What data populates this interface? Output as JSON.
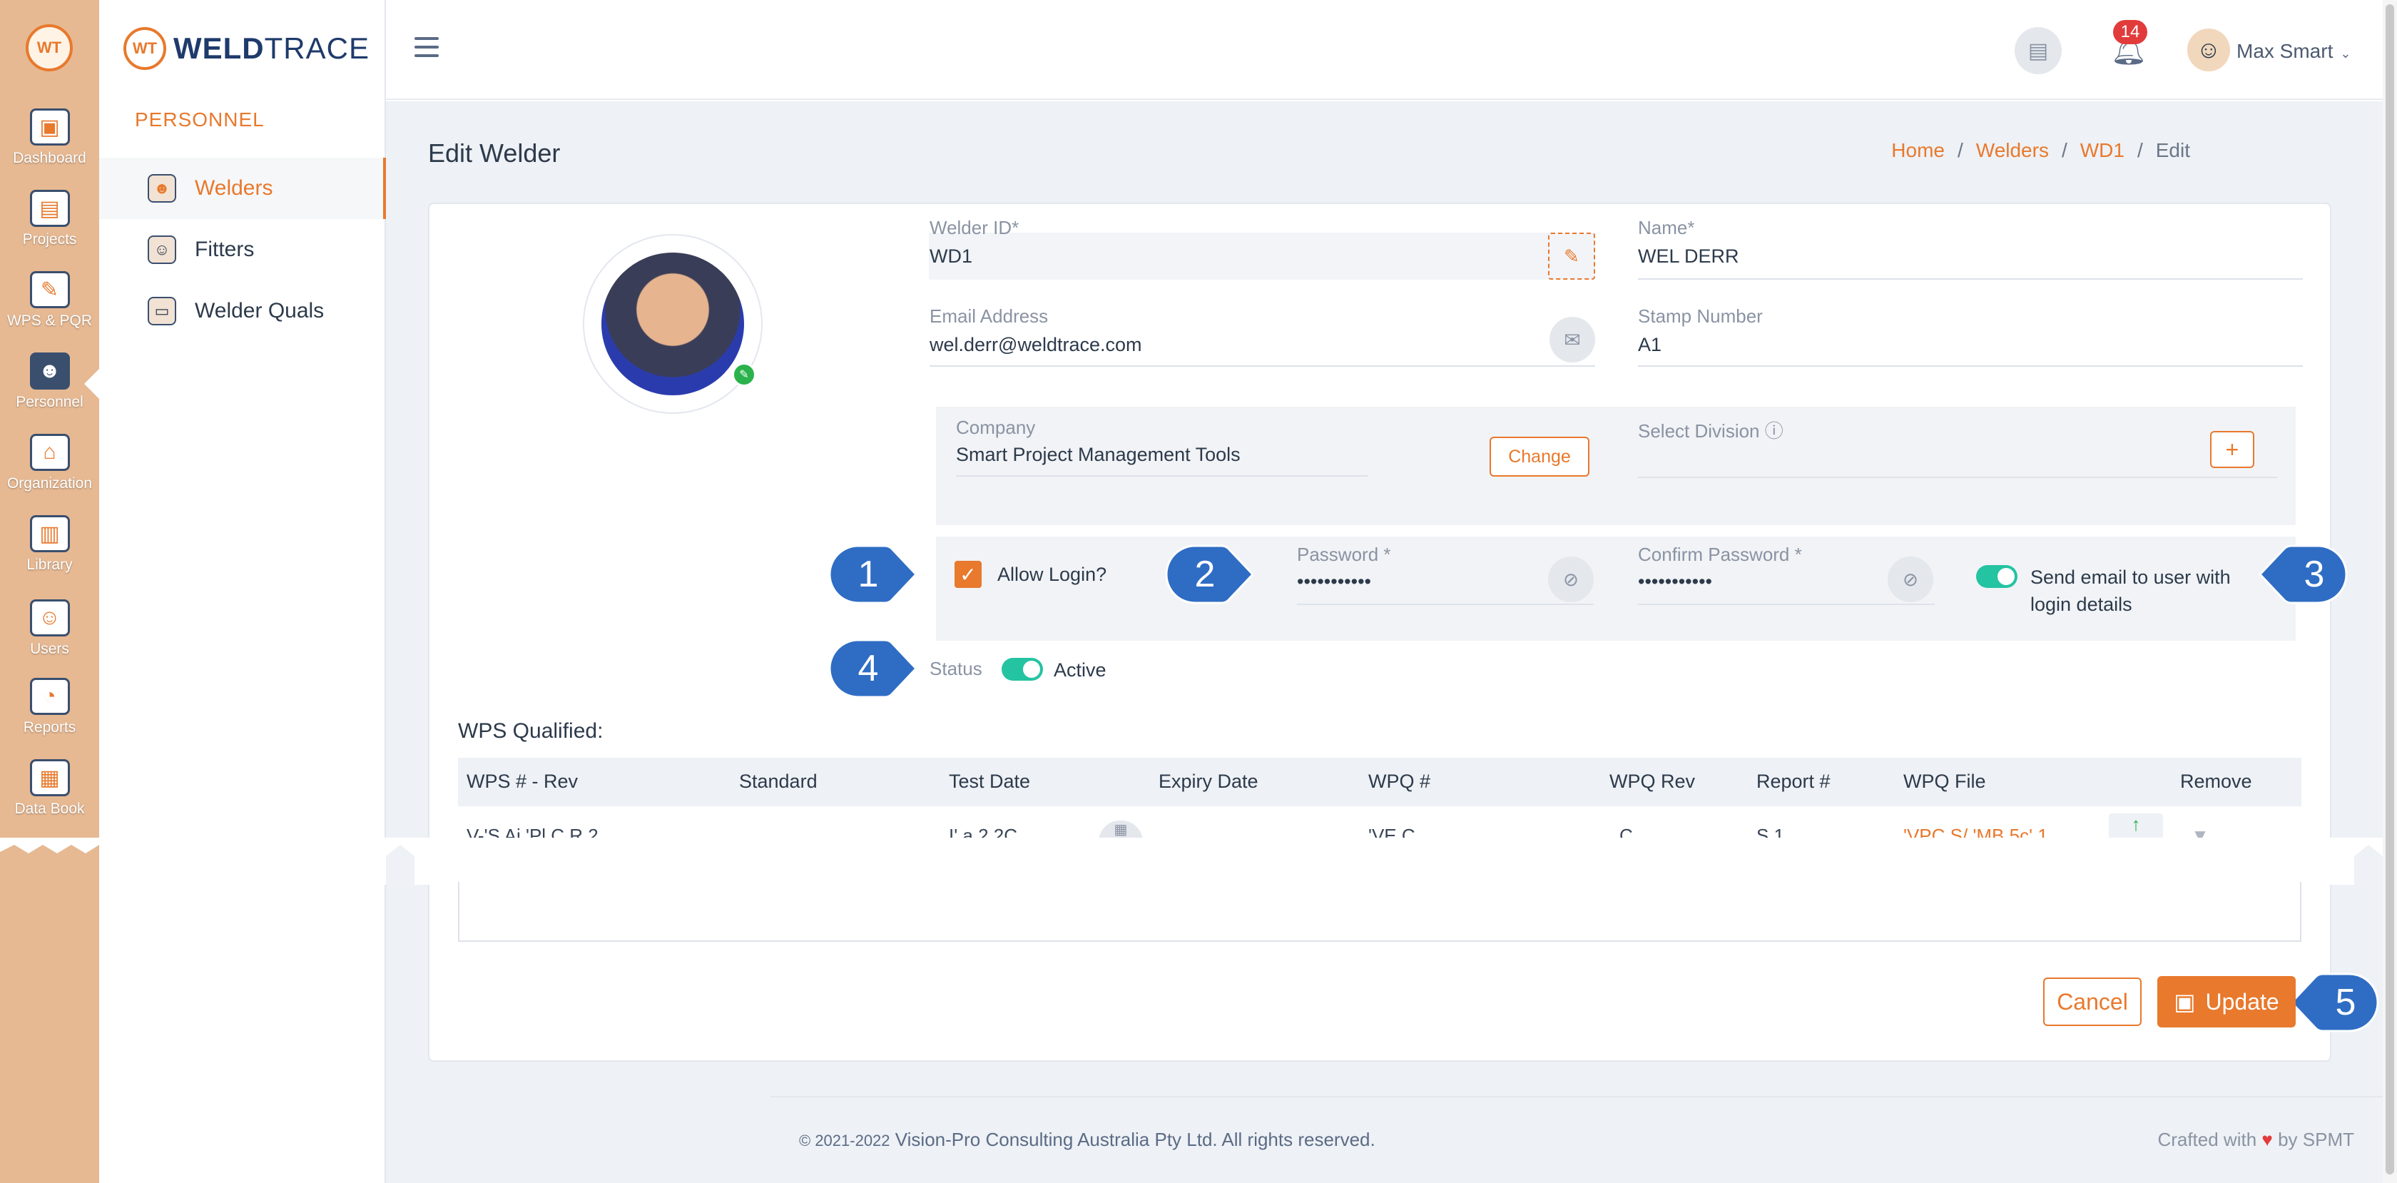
{
  "rail": {
    "logo": "WT",
    "items": [
      {
        "label": "Dashboard",
        "icon": "monitor-icon"
      },
      {
        "label": "Projects",
        "icon": "folder-icon"
      },
      {
        "label": "WPS & PQR",
        "icon": "clipboard-icon"
      },
      {
        "label": "Personnel",
        "icon": "welder-icon"
      },
      {
        "label": "Organization",
        "icon": "organization-icon"
      },
      {
        "label": "Library",
        "icon": "library-icon"
      },
      {
        "label": "Users",
        "icon": "users-icon"
      },
      {
        "label": "Reports",
        "icon": "reports-icon"
      },
      {
        "label": "Data Book",
        "icon": "databook-icon"
      }
    ]
  },
  "brand": {
    "mark": "WT",
    "name_bold": "WELD",
    "name_light": "TRACE"
  },
  "subnav": {
    "section": "PERSONNEL",
    "items": [
      {
        "label": "Welders",
        "active": true
      },
      {
        "label": "Fitters",
        "active": false
      },
      {
        "label": "Welder Quals",
        "active": false
      }
    ]
  },
  "topbar": {
    "notifications": "14",
    "user": "Max Smart"
  },
  "page": {
    "title": "Edit Welder",
    "breadcrumb": [
      "Home",
      "Welders",
      "WD1",
      "Edit"
    ]
  },
  "form": {
    "welder_id_label": "Welder ID*",
    "welder_id": "WD1",
    "name_label": "Name*",
    "name": "WEL DERR",
    "email_label": "Email Address",
    "email": "wel.derr@weldtrace.com",
    "stamp_label": "Stamp Number",
    "stamp": "A1",
    "company_label": "Company",
    "company": "Smart Project Management Tools",
    "change_label": "Change",
    "division_label": "Select Division ⓘ",
    "allow_login_label": "Allow Login?",
    "password_label": "Password *",
    "password": "•••••••••••",
    "confirm_label": "Confirm Password *",
    "confirm": "•••••••••••",
    "send_email_label": "Send email to user with login details",
    "status_label": "Status",
    "status_value": "Active"
  },
  "callouts": [
    "1",
    "2",
    "3",
    "4",
    "5"
  ],
  "table": {
    "title": "WPS Qualified:",
    "columns": [
      "WPS # - Rev",
      "Standard",
      "Test Date",
      "Expiry Date",
      "WPQ #",
      "WPQ Rev",
      "Report #",
      "WPQ File",
      "Remove"
    ],
    "partial_row": [
      "V-'S  Ai 'Pl  C  R  2",
      ".",
      "I'  a  2  2C",
      "",
      "'VE  C",
      "C",
      "S  1",
      "'VPC  S/ 'MB  5c'  1"
    ]
  },
  "actions": {
    "cancel": "Cancel",
    "update": "Update"
  },
  "footer": {
    "year": "© 2021-2022",
    "company": "Vision-Pro Consulting Australia Pty Ltd. All rights reserved.",
    "crafted": "Crafted with",
    "by": "by SPMT"
  },
  "colors": {
    "accent": "#e8792d",
    "toggle": "#24c3a2",
    "callout": "#2f6dc4",
    "rail": "#e6b993"
  }
}
